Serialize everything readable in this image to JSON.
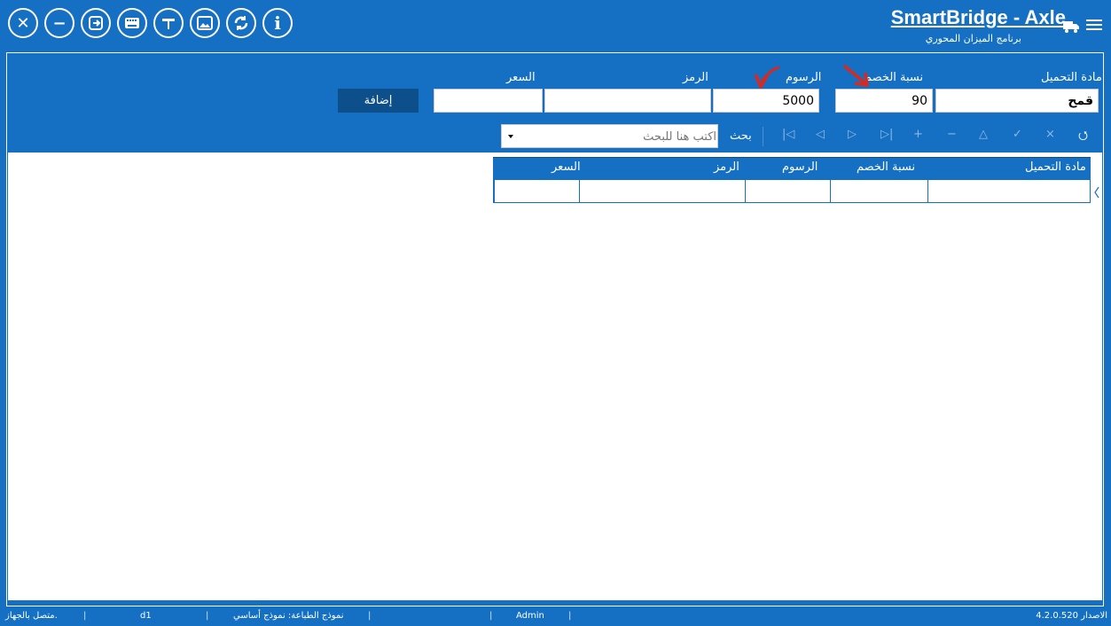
{
  "header": {
    "title": "SmartBridge - Axle",
    "subtitle": "برنامج الميزان المحوري",
    "toolbar_icons": [
      "close-circle-icon",
      "minus-circle-icon",
      "export-icon",
      "keyboard-icon",
      "scale-icon",
      "image-icon",
      "refresh-icon",
      "info-icon"
    ],
    "truck_icon": "truck-icon",
    "menu_icon": "hamburger-menu-icon"
  },
  "form": {
    "labels": {
      "material": "مادة التحميل",
      "discount": "نسبة الخصم",
      "fees": "الرسوم",
      "code": "الرمز",
      "price": "السعر"
    },
    "values": {
      "material": "قمح",
      "discount": "90",
      "fees": "5000",
      "code": "",
      "price": ""
    },
    "add_button": "إضافة"
  },
  "navigator": {
    "search_label": "بحث",
    "search_placeholder": "اكتب هنا للبحث",
    "buttons": [
      "⭯",
      "×",
      "✓",
      "△",
      "−",
      "+",
      "⊳|",
      "▷",
      "◁",
      "|◁"
    ]
  },
  "grid": {
    "columns": [
      "مادة التحميل",
      "نسبة الخصم",
      "الرسوم",
      "الرمز",
      "السعر"
    ],
    "rows": [
      [
        "",
        "",
        "",
        "",
        ""
      ]
    ]
  },
  "status": {
    "version": "الاصدار 4.2.0.520",
    "user": "Admin",
    "print_template": "نموذج الطباعة: نموذج أساسي",
    "device": "d1",
    "connection": "متصل بالجهاز."
  },
  "colors": {
    "primary": "#1570c4",
    "dark_button": "#0d4f8b",
    "annotation_arrow": "#d9281e"
  }
}
